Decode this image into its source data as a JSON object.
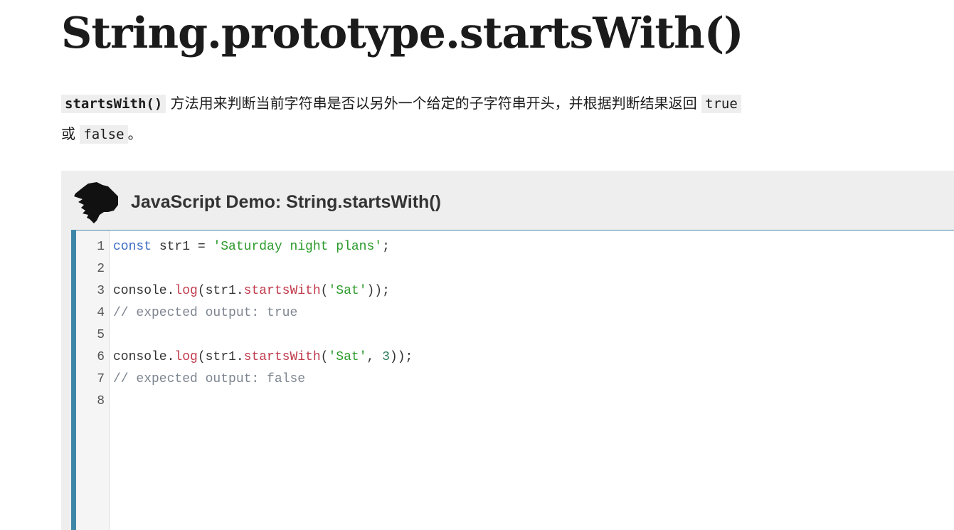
{
  "title": "String.prototype.startsWith()",
  "intro": {
    "code1": "startsWith()",
    "text1": " 方法用来判断当前字符串是否以另外一个给定的子字符串开头，并根据判断结果返回 ",
    "code2": "true",
    "text2": " 或 ",
    "code3": "false",
    "text3": "。"
  },
  "demo": {
    "title": "JavaScript Demo: String.startsWith()",
    "logo_icon": "dinosaur-head-icon",
    "lines": [
      {
        "num": "1",
        "tokens": [
          [
            "keyword",
            "const"
          ],
          [
            "plain",
            " str1 = "
          ],
          [
            "string",
            "'Saturday night plans'"
          ],
          [
            "plain",
            ";"
          ]
        ]
      },
      {
        "num": "2",
        "tokens": []
      },
      {
        "num": "3",
        "tokens": [
          [
            "plain",
            "console."
          ],
          [
            "func",
            "log"
          ],
          [
            "plain",
            "(str1."
          ],
          [
            "func",
            "startsWith"
          ],
          [
            "plain",
            "("
          ],
          [
            "string",
            "'Sat'"
          ],
          [
            "plain",
            "));"
          ]
        ]
      },
      {
        "num": "4",
        "tokens": [
          [
            "comment",
            "// expected output: true"
          ]
        ]
      },
      {
        "num": "5",
        "tokens": []
      },
      {
        "num": "6",
        "tokens": [
          [
            "plain",
            "console."
          ],
          [
            "func",
            "log"
          ],
          [
            "plain",
            "(str1."
          ],
          [
            "func",
            "startsWith"
          ],
          [
            "plain",
            "("
          ],
          [
            "string",
            "'Sat'"
          ],
          [
            "plain",
            ", "
          ],
          [
            "number",
            "3"
          ],
          [
            "plain",
            "));"
          ]
        ]
      },
      {
        "num": "7",
        "tokens": [
          [
            "comment",
            "// expected output: false"
          ]
        ]
      },
      {
        "num": "8",
        "tokens": []
      }
    ]
  }
}
